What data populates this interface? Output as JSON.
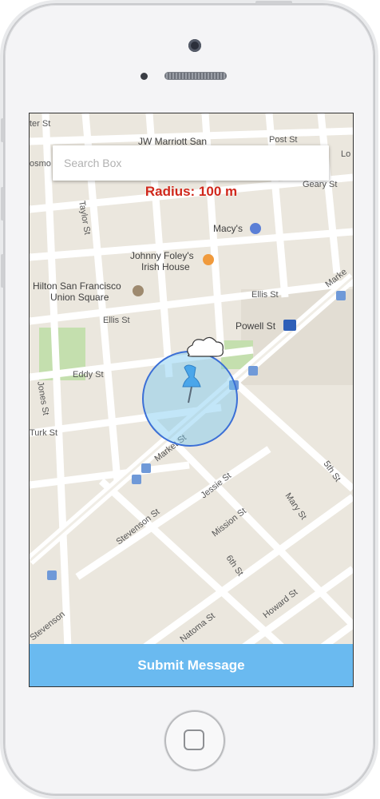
{
  "search": {
    "placeholder": "Search Box"
  },
  "radius_label": "Radius: 100 m",
  "submit_label": "Submit Message",
  "map": {
    "places": {
      "jw_marriott": "JW Marriott San",
      "macys": "Macy's",
      "johnny_foleys_line1": "Johnny Foley's",
      "johnny_foleys_line2": "Irish House",
      "hilton_line1": "Hilton San Francisco",
      "hilton_line2": "Union Square",
      "powell_st": "Powell St"
    },
    "streets": {
      "post_top_left": "ter St",
      "post": "Post St",
      "geary": "Geary St",
      "taylor": "Taylor St",
      "ellis": "Ellis St",
      "ellis_right": "Ellis St",
      "eddy": "Eddy St",
      "jones": "Jones St",
      "turk": "Turk St",
      "market": "Market St",
      "market_ne": "Marke",
      "jessie": "Jessie St",
      "stevenson": "Stevenson St",
      "mission": "Mission St",
      "mary": "Mary St",
      "fifth": "5th St",
      "sixth": "6th St",
      "howard": "Howard St",
      "natoma": "Natoma St",
      "stevenson_b": "Stevenson",
      "cosmo": "osmo",
      "lower_right": "Lo"
    },
    "colors": {
      "land": "#ebe7de",
      "street": "#ffffff",
      "park": "#c4dfae",
      "radius_fill": "rgba(120,200,240,0.45)",
      "radius_stroke": "#3b6fd6"
    }
  }
}
